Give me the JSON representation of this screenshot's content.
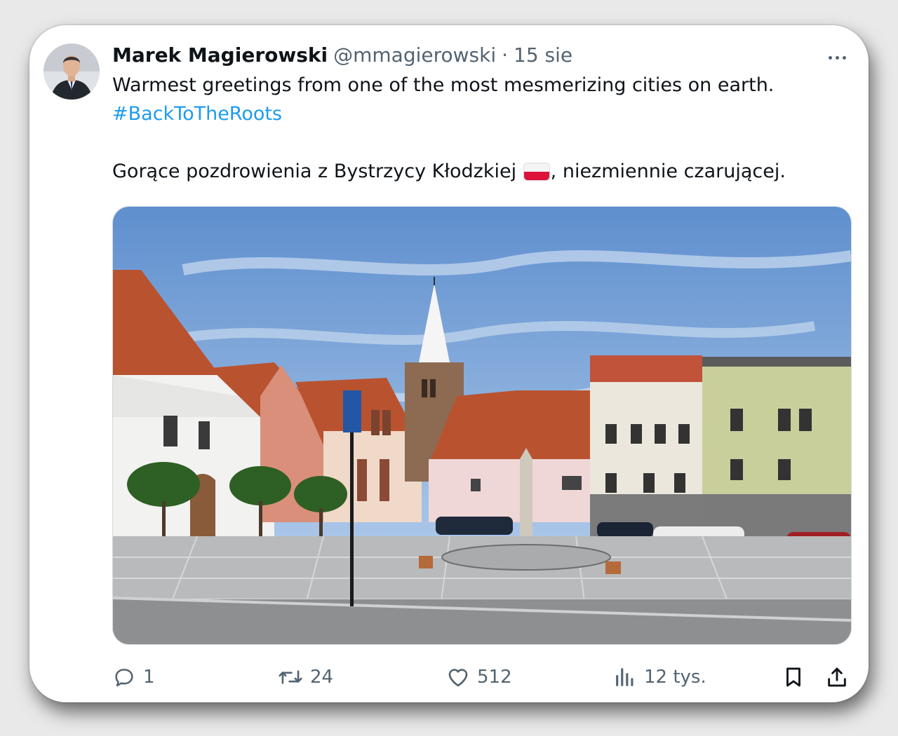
{
  "tweet": {
    "author_name": "Marek Magierowski",
    "handle": "@mmagierowski",
    "separator": "·",
    "date": "15 sie",
    "line1": "Warmest greetings from one of the most mesmerizing cities on earth.",
    "hashtag": "#BackToTheRoots",
    "line2_before_flag": "Gorące pozdrowienia z Bystrzycy Kłodzkiej ",
    "line2_after_flag": ", niezmiennie czarującej.",
    "flag_icon": "poland-flag-icon"
  },
  "actions": {
    "replies": "1",
    "retweets": "24",
    "likes": "512",
    "views": "12 tys."
  },
  "icons": {
    "more": "more-horizontal-icon",
    "reply": "reply-icon",
    "retweet": "retweet-icon",
    "like": "heart-icon",
    "views": "analytics-icon",
    "bookmark": "bookmark-icon",
    "share": "share-icon"
  },
  "colors": {
    "text": "#0f1419",
    "secondary": "#536471",
    "link": "#1d9bf0"
  }
}
